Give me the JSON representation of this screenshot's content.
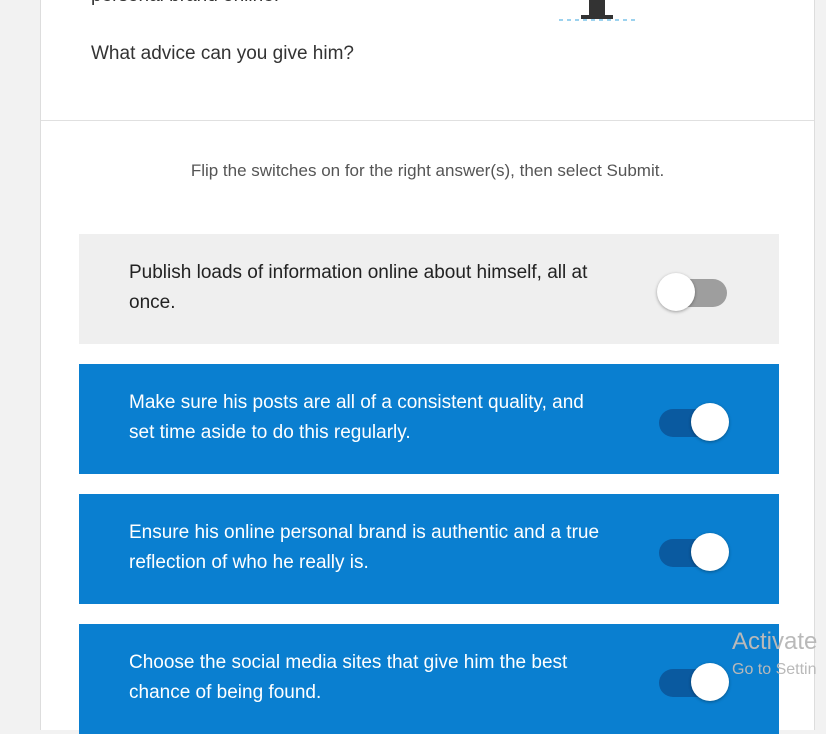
{
  "scenario": {
    "top_text": "personal brand online.",
    "question": "What advice can you give him?"
  },
  "instructions": "Flip the switches on for the right answer(s), then select Submit.",
  "options": [
    {
      "text": "Publish loads of information online about himself, all at once.",
      "state": "off"
    },
    {
      "text": "Make sure his posts are all of a consistent quality, and set time aside to do this regularly.",
      "state": "on"
    },
    {
      "text": "Ensure his online personal brand is authentic and a true reflection of who he really is.",
      "state": "on"
    },
    {
      "text": "Choose the social media sites that give him the best chance of being found.",
      "state": "on"
    }
  ],
  "watermark": {
    "line1": "Activate",
    "line2": "Go to Settin"
  },
  "colors": {
    "selected_bg": "#0a7fd0",
    "unselected_bg": "#efefef"
  }
}
